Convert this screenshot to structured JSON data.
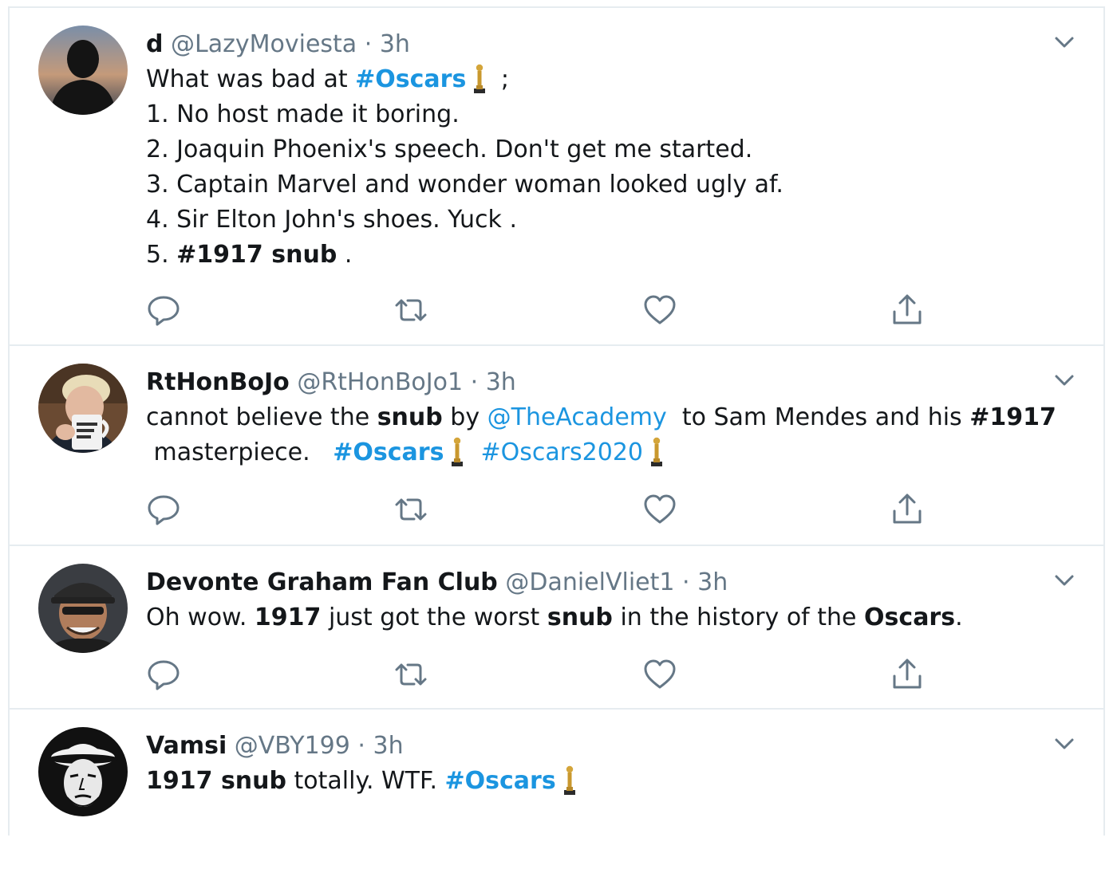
{
  "colors": {
    "link": "#1b95e0",
    "secondary_text": "#657786",
    "primary_text": "#14171a",
    "divider": "#e6ecf0"
  },
  "icons": {
    "reply": "reply-icon",
    "retweet": "retweet-icon",
    "like": "heart-icon",
    "share": "share-icon",
    "menu": "chevron-down-icon",
    "emoji": "trophy-icon"
  },
  "tweets": [
    {
      "name": "d",
      "handle": "@LazyMoviesta",
      "sep": "·",
      "time": "3h",
      "lines": {
        "l1": {
          "a": "What was bad at ",
          "tag": "#Oscars",
          "b": " ;"
        },
        "l2": "1. No host made it boring.",
        "l3": "2. Joaquin Phoenix's speech. Don't get me started.",
        "l4": "3. Captain Marvel and wonder woman looked ugly af.",
        "l5": "4. Sir Elton John's shoes. Yuck .",
        "l6": {
          "a": "5. ",
          "bold": "#1917 snub",
          "b": " ."
        }
      }
    },
    {
      "name": "RtHonBoJo",
      "handle": "@RtHonBoJo1",
      "sep": "·",
      "time": "3h",
      "lines": {
        "l1": {
          "a": "cannot believe the ",
          "bold1": "snub",
          "b": " by ",
          "mention": "@TheAcademy",
          "c": "  to Sam Mendes and his ",
          "bold2": "#1917"
        },
        "l2": {
          "a": " masterpiece.   ",
          "tag1": "#Oscars",
          "tag2": "#Oscars2020"
        }
      }
    },
    {
      "name": "Devonte Graham Fan Club",
      "handle": "@DanielVliet1",
      "sep": "·",
      "time": "3h",
      "lines": {
        "l1": {
          "a": "Oh wow. ",
          "bold1": "1917",
          "b": " just got the worst ",
          "bold2": "snub",
          "c": " in the history of the ",
          "bold3": "Oscars",
          "d": "."
        }
      }
    },
    {
      "name": "Vamsi",
      "handle": "@VBY199",
      "sep": "·",
      "time": "3h",
      "lines": {
        "l1": {
          "bold1": "1917 snub",
          "a": " totally. WTF. ",
          "tag": "#Oscars"
        }
      }
    }
  ]
}
